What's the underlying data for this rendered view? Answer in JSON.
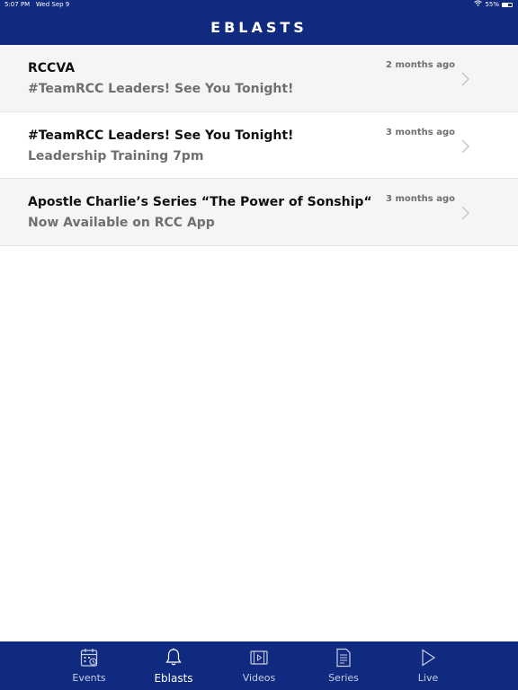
{
  "status_bar": {
    "time": "5:07 PM",
    "date": "Wed Sep 9",
    "battery": "55%",
    "battery_level": 0.55
  },
  "header": {
    "title": "EBLASTS",
    "background_color": "#0f2a7e"
  },
  "list": {
    "items": [
      {
        "title": "RCCVA",
        "subtitle": "#TeamRCC Leaders! See You Tonight!",
        "time": "2 months ago"
      },
      {
        "title": "#TeamRCC Leaders! See You Tonight!",
        "subtitle": "Leadership Training 7pm",
        "time": "3 months ago"
      },
      {
        "title": "Apostle Charlie’s Series “The Power of Sonship“",
        "subtitle": "Now Available on RCC App",
        "time": "3 months ago"
      }
    ]
  },
  "tabbar": {
    "tabs": [
      {
        "label": "Events",
        "icon": "calendar-icon",
        "active": false
      },
      {
        "label": "Eblasts",
        "icon": "bell-icon",
        "active": true
      },
      {
        "label": "Videos",
        "icon": "film-icon",
        "active": false
      },
      {
        "label": "Series",
        "icon": "document-icon",
        "active": false
      },
      {
        "label": "Live",
        "icon": "play-icon",
        "active": false
      }
    ]
  }
}
